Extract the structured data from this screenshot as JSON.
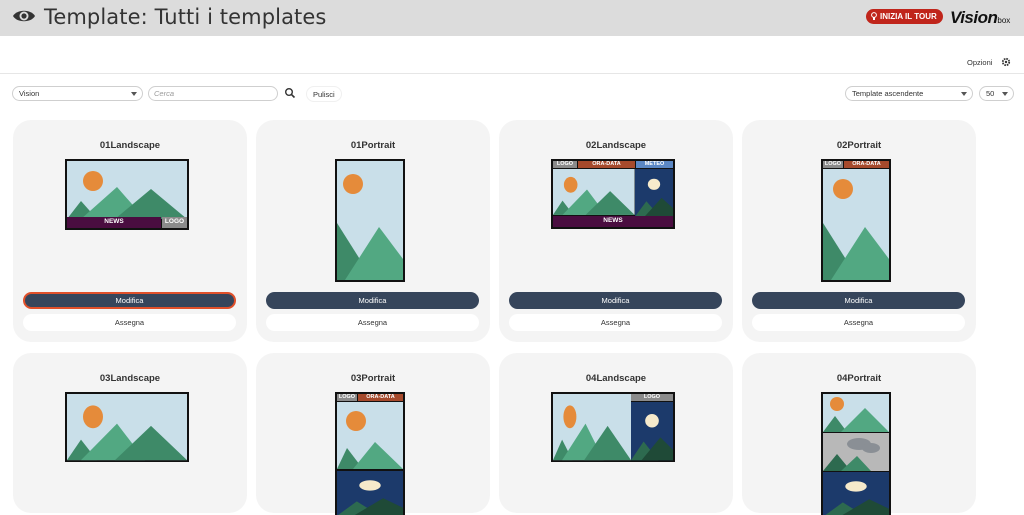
{
  "header": {
    "title": "Template: Tutti i templates",
    "tour_label": "INIZIA IL TOUR",
    "logo_main": "Vision",
    "logo_sub": "box"
  },
  "options": {
    "label": "Opzioni"
  },
  "filters": {
    "group_select": "Vision",
    "search_placeholder": "Cerca",
    "clear_label": "Pulisci",
    "sort_select": "Template ascendente",
    "page_size": "50"
  },
  "cards": [
    {
      "name": "01Landscape",
      "edit_label": "Modifica",
      "assign_label": "Assegna",
      "selected": true,
      "zones": {
        "bottom_left": "NEWS",
        "bottom_right": "LOGO"
      }
    },
    {
      "name": "01Portrait",
      "edit_label": "Modifica",
      "assign_label": "Assegna"
    },
    {
      "name": "02Landscape",
      "edit_label": "Modifica",
      "assign_label": "Assegna",
      "zones": {
        "top_1": "LOGO",
        "top_2": "ORA-DATA",
        "top_3": "METEO",
        "bottom": "NEWS"
      }
    },
    {
      "name": "02Portrait",
      "edit_label": "Modifica",
      "assign_label": "Assegna",
      "zones": {
        "top_1": "LOGO",
        "top_2": "ORA-DATA"
      }
    },
    {
      "name": "03Landscape"
    },
    {
      "name": "03Portrait",
      "zones": {
        "top_1": "LOGO",
        "top_2": "ORA-DATA"
      }
    },
    {
      "name": "04Landscape",
      "zones": {
        "top_right": "LOGO"
      }
    },
    {
      "name": "04Portrait"
    }
  ],
  "colors": {
    "header_bg": "#dcdcdc",
    "tour_red": "#c0251b",
    "edit_button": "#36455b",
    "card_bg": "#f4f4f4",
    "sky": "#c9dfe9",
    "sun": "#e58b3a",
    "mountain_dark": "#3e8a68",
    "mountain_light": "#52a882",
    "night": "#1c3a6b",
    "news_bar": "#4a0d40",
    "ora_data": "#a64a2c",
    "meteo": "#5b87c4",
    "logo_zone": "#8b8b8b"
  }
}
